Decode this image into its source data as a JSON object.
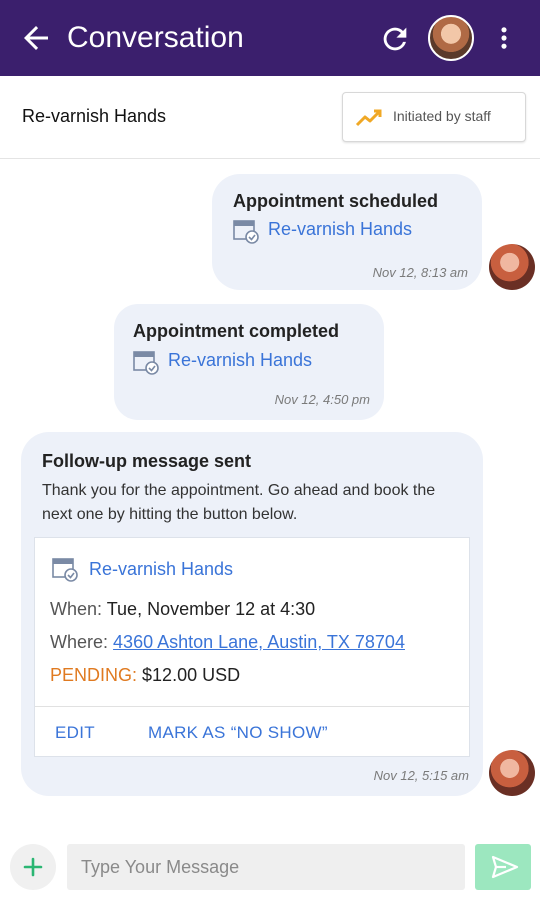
{
  "header": {
    "title": "Conversation",
    "back_icon": "arrow-left-icon",
    "refresh_icon": "refresh-icon",
    "menu_icon": "more-vertical-icon",
    "background": "#3b1f6d"
  },
  "subheader": {
    "title": "Re-varnish Hands",
    "initiated_label": "Initiated by staff",
    "initiated_icon": "trending-up-icon"
  },
  "messages": [
    {
      "title": "Appointment scheduled",
      "service": "Re-varnish Hands",
      "timestamp": "Nov 12, 8:13 am"
    },
    {
      "title": "Appointment completed",
      "service": "Re-varnish Hands",
      "timestamp": "Nov 12, 4:50 pm"
    },
    {
      "title": "Follow-up message sent",
      "body": "Thank you for the appointment. Go ahead and book the next one by hitting the button below.",
      "card": {
        "service": "Re-varnish Hands",
        "when_label": "When:",
        "when_value": "Tue, November 12 at 4:30",
        "where_label": "Where:",
        "where_value": "4360 Ashton Lane, Austin, TX 78704",
        "status_label": "PENDING:",
        "price": "$12.00 USD",
        "edit_label": "EDIT",
        "no_show_label": "MARK AS “NO SHOW”"
      },
      "timestamp": "Nov 12, 5:15 am"
    }
  ],
  "composer": {
    "placeholder": "Type Your Message",
    "send_color": "#9ce7bf"
  },
  "colors": {
    "link": "#3a74d8",
    "pending": "#e07a20",
    "bubble": "#edf1f9"
  }
}
